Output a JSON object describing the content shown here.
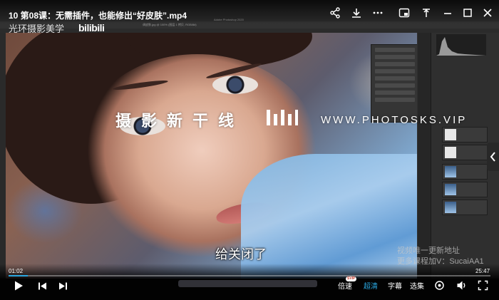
{
  "video": {
    "title": "10 第08课：无需插件，也能修出“好皮肤”.mp4",
    "channel_watermark": "光环摄影美学",
    "platform_logo": "bilibili",
    "subtitle": "给关闭了",
    "current_time": "01:02",
    "duration": "25:47",
    "progress": 0.04
  },
  "overlay": {
    "brand_cn": "摄影新干线",
    "brand_url": "WWW.PHOTOSKS.VIP",
    "notice_line1": "视频唯一更新地址",
    "notice_line2": "更多课程加V：SucaiAA1"
  },
  "controls": {
    "speed_label": "倍速",
    "speed_badge": "SVIP",
    "quality_label": "超清",
    "subtitle_label": "字幕",
    "episodes_label": "选集"
  },
  "photoshop": {
    "app_title": "Adobe Photoshop 2020",
    "tab_label": "调皮肤.jpg @ 100% (图层 1 拷贝, RGB/8#)"
  },
  "colors": {
    "accent": "#2aa7e0",
    "background": "#0b0b0d"
  }
}
